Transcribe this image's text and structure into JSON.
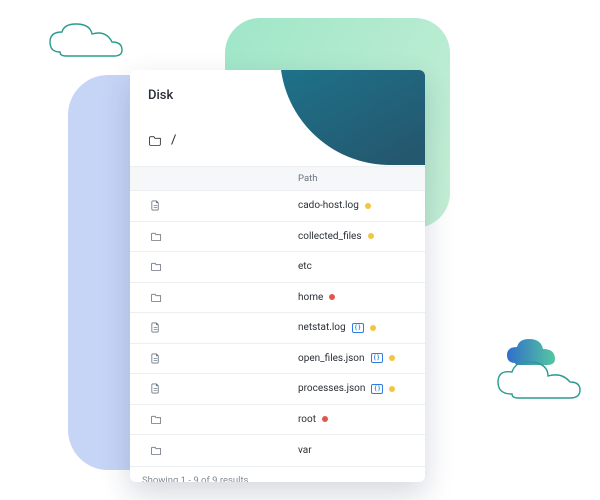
{
  "decor": {
    "cloud_outline_stroke": "#2a9b90",
    "blob_left_color": "#c6d5f6",
    "blob_right_gradient": [
      "#9fe6c8",
      "#c5efd6"
    ],
    "cloud_grad": [
      "#2f6fca",
      "#55c7a0"
    ]
  },
  "card": {
    "title": "Disk",
    "breadcrumb_path": "/",
    "path_header": "Path",
    "footer_text": "Showing 1 - 9 of 9 results"
  },
  "rows": [
    {
      "kind": "file",
      "name": "cado-host.log",
      "badges": [],
      "dots": [
        "yellow"
      ]
    },
    {
      "kind": "folder",
      "name": "collected_files",
      "badges": [],
      "dots": [
        "yellow"
      ]
    },
    {
      "kind": "folder",
      "name": "etc",
      "badges": [],
      "dots": []
    },
    {
      "kind": "folder",
      "name": "home",
      "badges": [],
      "dots": [
        "red"
      ]
    },
    {
      "kind": "file",
      "name": "netstat.log",
      "badges": [
        "json"
      ],
      "dots": [
        "yellow"
      ]
    },
    {
      "kind": "file",
      "name": "open_files.json",
      "badges": [
        "json"
      ],
      "dots": [
        "yellow"
      ]
    },
    {
      "kind": "file",
      "name": "processes.json",
      "badges": [
        "json"
      ],
      "dots": [
        "yellow"
      ]
    },
    {
      "kind": "folder",
      "name": "root",
      "badges": [],
      "dots": [
        "red"
      ]
    },
    {
      "kind": "folder",
      "name": "var",
      "badges": [],
      "dots": []
    }
  ]
}
